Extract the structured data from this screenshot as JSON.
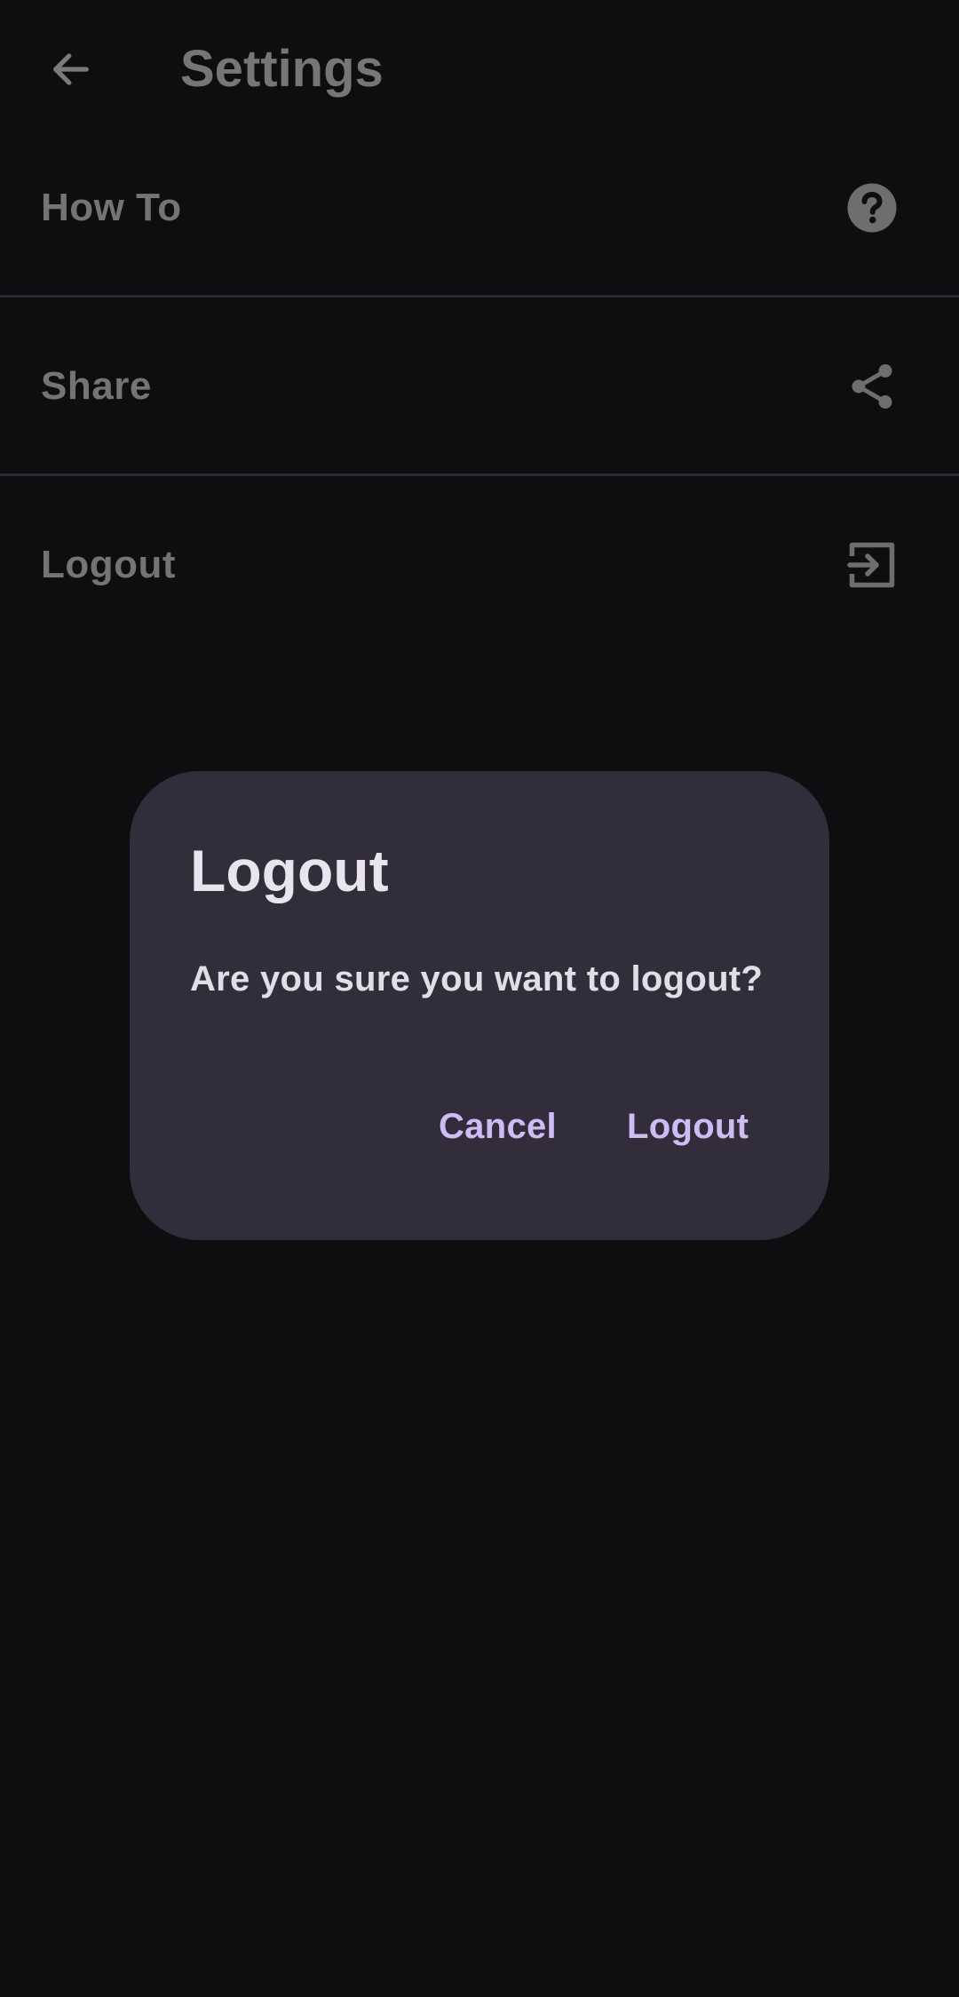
{
  "app_bar": {
    "title": "Settings",
    "back_icon": "arrow-back-icon"
  },
  "settings_items": [
    {
      "label": "How To",
      "icon": "help-circle-icon"
    },
    {
      "label": "Share",
      "icon": "share-icon"
    },
    {
      "label": "Logout",
      "icon": "logout-icon"
    }
  ],
  "dialog": {
    "title": "Logout",
    "message": "Are you sure you want to logout?",
    "cancel_label": "Cancel",
    "confirm_label": "Logout"
  },
  "colors": {
    "background": "#0e0e10",
    "dialog_surface": "#312d3a",
    "dialog_action": "#cfbcf5",
    "dimmed_text": "#747476"
  }
}
